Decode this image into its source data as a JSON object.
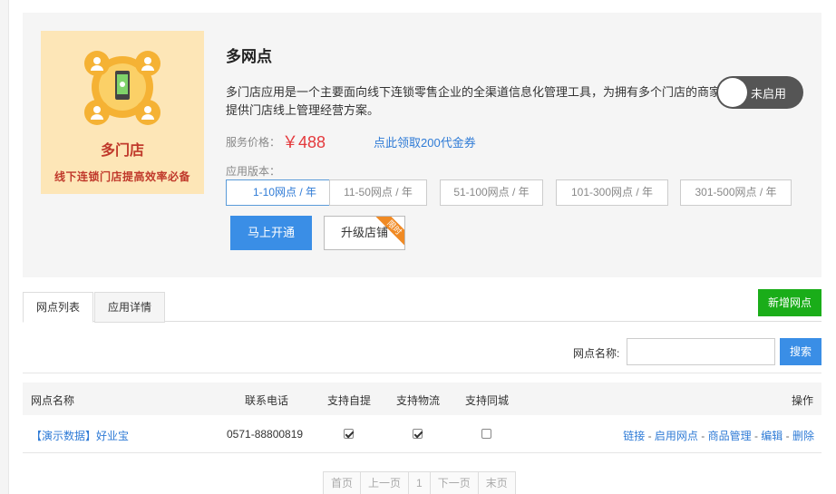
{
  "app": {
    "title": "多网点",
    "description": "多门店应用是一个主要面向线下连锁零售企业的全渠道信息化管理工具，为拥有多个门店的商家提供门店线上管理经营方案。",
    "status_label": "未启用",
    "price_label": "服务价格：",
    "price_value": "￥488",
    "coupon_link": "点此领取200代金券",
    "version_label": "应用版本：",
    "versions": [
      "1-10网点 / 年",
      "11-50网点 / 年",
      "51-100网点 / 年",
      "101-300网点 / 年",
      "301-500网点 / 年"
    ],
    "selected_version": "1-10网点 / 年",
    "open_button": "马上开通",
    "upgrade_button": "升级店铺",
    "upgrade_ribbon": "限时",
    "banner": {
      "title": "多门店",
      "subtitle": "线下连锁门店提高效率必备"
    }
  },
  "tabs": [
    {
      "label": "网点列表",
      "active": true
    },
    {
      "label": "应用详情",
      "active": false
    }
  ],
  "add_button": "新增网点",
  "search": {
    "label": "网点名称:",
    "value": "",
    "placeholder": "",
    "button": "搜索"
  },
  "table": {
    "headers": [
      "网点名称",
      "联系电话",
      "支持自提",
      "支持物流",
      "支持同城",
      "操作"
    ],
    "rows": [
      {
        "name": "【演示数据】好业宝",
        "phone": "0571-88800819",
        "self_pickup": true,
        "logistics": true,
        "same_city": false,
        "actions": [
          "链接",
          "启用网点",
          "商品管理",
          "编辑",
          "删除"
        ]
      }
    ]
  },
  "pager": {
    "first": "首页",
    "prev": "上一页",
    "current": "1",
    "next": "下一页",
    "last": "末页"
  },
  "colors": {
    "accent": "#3a8ee6",
    "price": "#e4393c",
    "add_green": "#1aad19",
    "toggle_bg": "#555555",
    "banner_bg": "#fde6b7"
  }
}
